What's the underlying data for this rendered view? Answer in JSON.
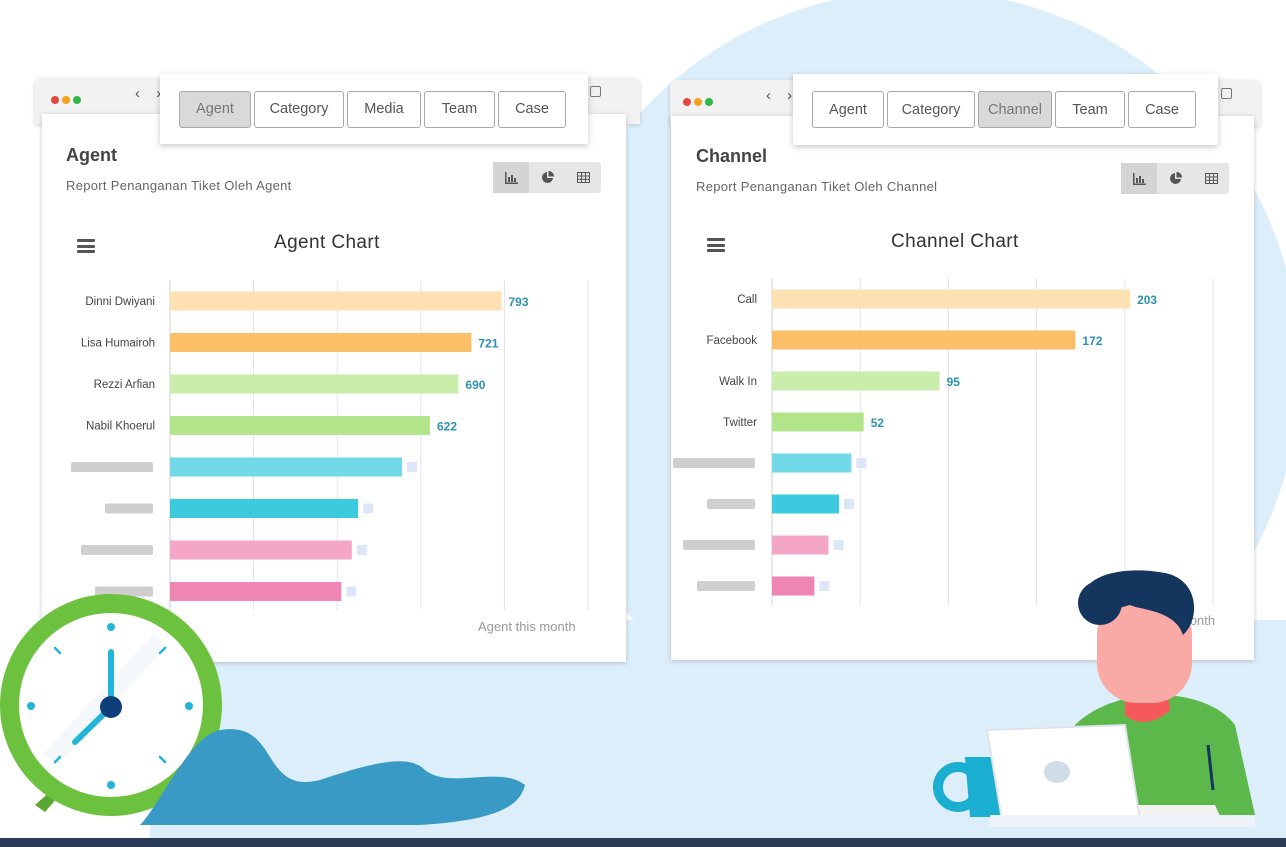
{
  "left_window": {
    "tabs": [
      {
        "label": "Agent",
        "active": true
      },
      {
        "label": "Category",
        "active": false
      },
      {
        "label": "Media",
        "active": false
      },
      {
        "label": "Team",
        "active": false
      },
      {
        "label": "Case",
        "active": false
      }
    ],
    "panel_title": "Agent",
    "panel_subtitle": "Report Penanganan Tiket Oleh Agent",
    "view_icons": [
      "bar-chart-icon",
      "pie-chart-icon",
      "table-icon"
    ],
    "menu_icon": "hamburger-icon",
    "x_axis_label": "Agent this month"
  },
  "right_window": {
    "tabs": [
      {
        "label": "Agent",
        "active": false
      },
      {
        "label": "Category",
        "active": false
      },
      {
        "label": "Channel",
        "active": true
      },
      {
        "label": "Team",
        "active": false
      },
      {
        "label": "Case",
        "active": false
      }
    ],
    "panel_title": "Channel",
    "panel_subtitle": "Report Penanganan Tiket Oleh Channel",
    "view_icons": [
      "bar-chart-icon",
      "pie-chart-icon",
      "table-icon"
    ],
    "menu_icon": "hamburger-icon",
    "x_axis_label": "month"
  },
  "chart_data": [
    {
      "type": "bar",
      "orientation": "horizontal",
      "title": "Agent Chart",
      "categories": [
        "Dinni Dwiyani",
        "Lisa Humairoh",
        "Rezzi Arfian",
        "Nabil Khoerul",
        "",
        "",
        "",
        ""
      ],
      "values": [
        793,
        721,
        690,
        622,
        555,
        450,
        435,
        410
      ],
      "value_labels": [
        "793",
        "721",
        "690",
        "622",
        "",
        "",
        "",
        ""
      ],
      "colors": [
        "#fde1b2",
        "#fbbf67",
        "#c9eeab",
        "#b2e58a",
        "#72d9e9",
        "#3ccbde",
        "#f4a6c7",
        "#ef85b2"
      ],
      "xlim": [
        0,
        1000
      ],
      "xlabel": "Agent this month",
      "grid": true
    },
    {
      "type": "bar",
      "orientation": "horizontal",
      "title": "Channel Chart",
      "categories": [
        "Call",
        "Facebook",
        "Walk In",
        "Twitter",
        "",
        "",
        "",
        ""
      ],
      "values": [
        203,
        172,
        95,
        52,
        45,
        38,
        32,
        24
      ],
      "value_labels": [
        "203",
        "172",
        "95",
        "52",
        "",
        "",
        "",
        ""
      ],
      "colors": [
        "#fde1b2",
        "#fbbf67",
        "#c9eeab",
        "#b2e58a",
        "#72d9e9",
        "#3ccbde",
        "#f4a6c7",
        "#ef85b2"
      ],
      "xlim": [
        0,
        250
      ],
      "xlabel": "month",
      "grid": true
    }
  ],
  "colors": {
    "background_blob": "#ddeefb",
    "value_label": "#2b93b0",
    "placeholder_label": "#cfcfcf",
    "placeholder_value": "#dde6f7",
    "clock_rim": "#6cc23e",
    "clock_hands": "#22b5d8",
    "person_shirt": "#5cb84a",
    "person_hair": "#14355e"
  }
}
